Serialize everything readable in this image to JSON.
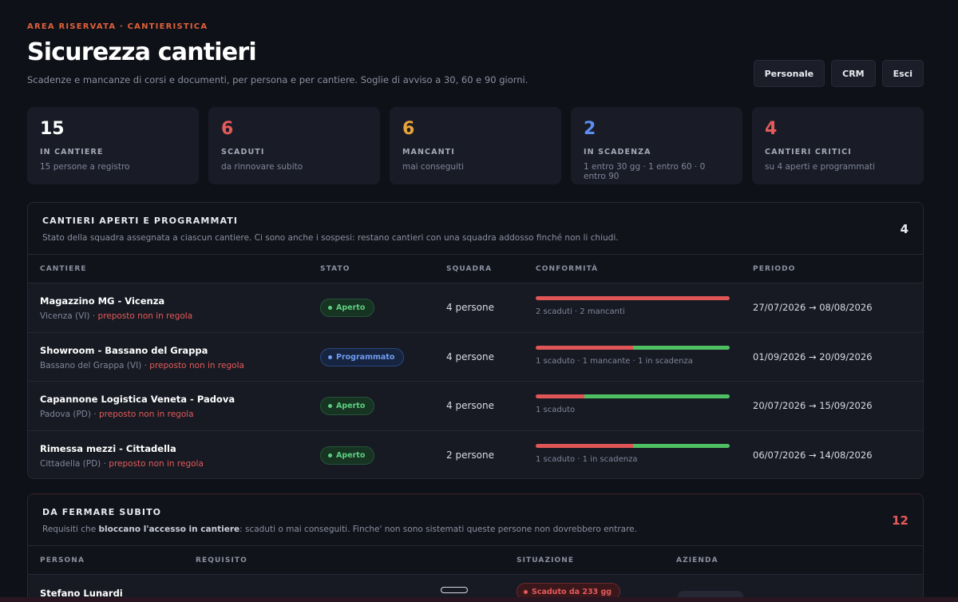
{
  "header": {
    "eyebrow": "AREA RISERVATA · CANTIERISTICA",
    "title": "Sicurezza cantieri",
    "subtitle": "Scadenze e mancanze di corsi e documenti, per persona e per cantiere. Soglie di avviso a 30, 60 e 90 giorni.",
    "buttons": [
      "Personale",
      "CRM",
      "Esci"
    ]
  },
  "kpis": [
    {
      "value": "15",
      "label": "IN CANTIERE",
      "hint": "15 persone a registro",
      "color": "#ffffff"
    },
    {
      "value": "6",
      "label": "SCADUTI",
      "hint": "da rinnovare subito",
      "color": "#e55a5a"
    },
    {
      "value": "6",
      "label": "MANCANTI",
      "hint": "mai conseguiti",
      "color": "#e8a33a"
    },
    {
      "value": "2",
      "label": "IN SCADENZA",
      "hint": "1 entro 30 gg · 1 entro 60 · 0 entro 90",
      "color": "#5b8ef0"
    },
    {
      "value": "4",
      "label": "CANTIERI CRITICI",
      "hint": "su 4 aperti e programmati",
      "color": "#e55a5a"
    }
  ],
  "sites_panel": {
    "title": "CANTIERI APERTI E PROGRAMMATI",
    "description": "Stato della squadra assegnata a ciascun cantiere. Ci sono anche i sospesi: restano cantieri con una squadra addosso finché non li chiudi.",
    "count": "4",
    "columns": [
      "CANTIERE",
      "STATO",
      "SQUADRA",
      "CONFORMITÀ",
      "PERIODO"
    ],
    "rows": [
      {
        "name": "Magazzino MG - Vicenza",
        "location": "Vicenza (VI) · ",
        "warning": "preposto non in regola",
        "status": "Aperto",
        "status_kind": "open",
        "team": "4 persone",
        "conformity_red": 1.0,
        "conformity_note": "2 scaduti · 2 mancanti",
        "period": "27/07/2026 → 08/08/2026"
      },
      {
        "name": "Showroom - Bassano del Grappa",
        "location": "Bassano del Grappa (VI) · ",
        "warning": "preposto non in regola",
        "status": "Programmato",
        "status_kind": "plan",
        "team": "4 persone",
        "conformity_red": 0.5,
        "conformity_note": "1 scaduto · 1 mancante · 1 in scadenza",
        "period": "01/09/2026 → 20/09/2026"
      },
      {
        "name": "Capannone Logistica Veneta - Padova",
        "location": "Padova (PD) · ",
        "warning": "preposto non in regola",
        "status": "Aperto",
        "status_kind": "open",
        "team": "4 persone",
        "conformity_red": 0.25,
        "conformity_note": "1 scaduto",
        "period": "20/07/2026 → 15/09/2026"
      },
      {
        "name": "Rimessa mezzi - Cittadella",
        "location": "Cittadella (PD) · ",
        "warning": "preposto non in regola",
        "status": "Aperto",
        "status_kind": "open",
        "team": "2 persone",
        "conformity_red": 0.5,
        "conformity_note": "1 scaduto · 1 in scadenza",
        "period": "06/07/2026 → 14/08/2026"
      }
    ]
  },
  "stop_panel": {
    "title": "DA FERMARE SUBITO",
    "description_pre": "Requisiti che ",
    "description_bold": "bloccano l'accesso in cantiere",
    "description_post": ": scaduti o mai conseguiti. Finche' non sono sistemati queste persone non dovrebbero entrare.",
    "count": "12",
    "columns": [
      "PERSONA",
      "REQUISITO",
      "SITUAZIONE",
      "AZIENDA"
    ],
    "rows": [
      {
        "person": "Stefano Lunardi",
        "situation": "Scaduto da 233 gg"
      }
    ]
  }
}
